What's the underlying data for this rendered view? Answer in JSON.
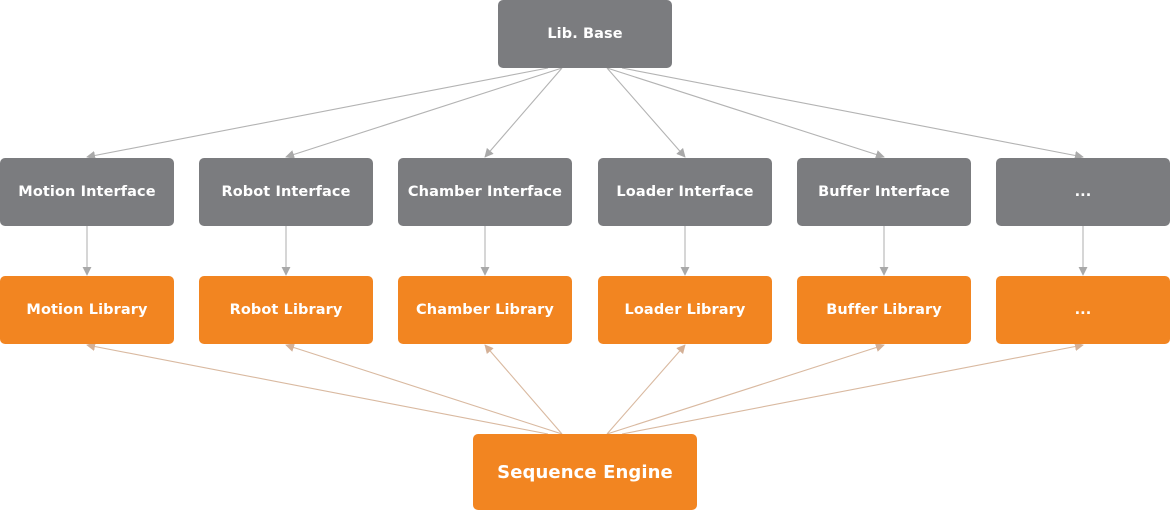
{
  "colors": {
    "interface_box": "#7b7c7f",
    "library_box": "#f28521",
    "interface_edge": "#b3b3b3",
    "library_edge": "#d9b9a0",
    "text": "#ffffff"
  },
  "nodes": {
    "base": {
      "label": "Lib. Base"
    },
    "interfaces": [
      {
        "label": "Motion Interface"
      },
      {
        "label": "Robot Interface"
      },
      {
        "label": "Chamber Interface"
      },
      {
        "label": "Loader Interface"
      },
      {
        "label": "Buffer Interface"
      },
      {
        "label": "..."
      }
    ],
    "libraries": [
      {
        "label": "Motion Library"
      },
      {
        "label": "Robot Library"
      },
      {
        "label": "Chamber Library"
      },
      {
        "label": "Loader Library"
      },
      {
        "label": "Buffer Library"
      },
      {
        "label": "..."
      }
    ],
    "engine": {
      "label": "Sequence Engine"
    }
  },
  "edges": [
    {
      "from": "Lib. Base",
      "to": "Motion Interface"
    },
    {
      "from": "Lib. Base",
      "to": "Robot Interface"
    },
    {
      "from": "Lib. Base",
      "to": "Chamber Interface"
    },
    {
      "from": "Lib. Base",
      "to": "Loader Interface"
    },
    {
      "from": "Lib. Base",
      "to": "Buffer Interface"
    },
    {
      "from": "Lib. Base",
      "to": "..."
    },
    {
      "from": "Motion Interface",
      "to": "Motion Library"
    },
    {
      "from": "Robot Interface",
      "to": "Robot Library"
    },
    {
      "from": "Chamber Interface",
      "to": "Chamber Library"
    },
    {
      "from": "Loader Interface",
      "to": "Loader Library"
    },
    {
      "from": "Buffer Interface",
      "to": "Buffer Library"
    },
    {
      "from": "...",
      "to": "..."
    },
    {
      "from": "Sequence Engine",
      "to": "Motion Library"
    },
    {
      "from": "Sequence Engine",
      "to": "Robot Library"
    },
    {
      "from": "Sequence Engine",
      "to": "Chamber Library"
    },
    {
      "from": "Sequence Engine",
      "to": "Loader Library"
    },
    {
      "from": "Sequence Engine",
      "to": "Buffer Library"
    },
    {
      "from": "Sequence Engine",
      "to": "..."
    }
  ]
}
